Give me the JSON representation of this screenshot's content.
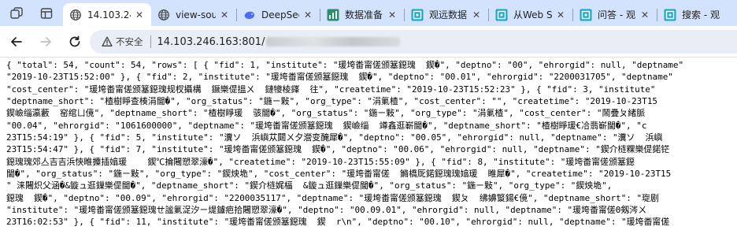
{
  "tabs": [
    {
      "title": "14.103.24",
      "active": true
    },
    {
      "title": "view-sou",
      "active": false
    },
    {
      "title": "DeepSeek",
      "active": false
    },
    {
      "title": "数据准备",
      "active": false
    },
    {
      "title": "观远数据",
      "active": false
    },
    {
      "title": "从Web S",
      "active": false
    },
    {
      "title": "问答 - 观",
      "active": false
    },
    {
      "title": "搜索 - 观",
      "active": false
    }
  ],
  "toolbar": {
    "security_label": "不安全",
    "url": "14.103.246.163:801/"
  },
  "json_lines": [
    "{ \"total\": 54, \"count\": 54, \"rows\": [ { \"fid\": 1, \"institute\": \"瑗垮畨甯傞颁簊鐚瑰  鍥�\", \"deptno\": \"00\", \"ehrorgid\": null, \"deptname\"",
    "\"2019-10-23T15:52:00\" }, { \"fid\": 2, \"institute\": \"瑗垮畨甯傞颁簊鐚瑰  鍥�\", \"deptno\": \"00.01\", \"ehrorgid\": \"2200031705\", \"deptname\"",
    "\"cost_center\": \"瑗垮畨甯傞颁簊鐚瑰规杈攝構  鐝樂偍搵ㄨ  鏈犪棱鎽  往\", \"createtime\": \"2019-10-23T15:52:23\" }, { \"fid\": 3, \"institute\"",
    "\"deptname_short\": \"楂樹睜查楱涓閫�\", \"org_status\": \"鍦ㄧ敤\", \"org_type\": \"涓氭楂\", \"cost_center\": \"\", \"createtime\": \"2019-10-23T15",
    "鍥嶮缁瀛藪  窑绾ㄩ傹\", \"deptname_short\": \"楂樹睜瑗  骇閫�\", \"org_status\": \"鍦ㄧ敤\", \"org_type\": \"涓氭楂\", \"cost_center\": \"鬧疊ㄆ緒脈",
    "\"00.04\", \"ehrorgid\": \"1061600000\", \"deptname\": \"瑗垮畨甯傞颁簊鐚瑰  鍥嶮缁  竴鑫逛嶄閫�\", \"deptname_short\": \"楂樹睜瑗€冾翡嶄閫�\", \"c",
    "23T15:54:19\" }, { \"fid\": 5, \"institute\": \"瀵ソ  浜嶼苁閮ㄨ夕瀯变醃犀�\", \"deptno\": \"00.05\", \"ehrorgid\": null, \"deptname\": \"瀵ソ  浜嶼",
    "23T15:54:47\" }, { \"fid\": 7, \"institute\": \"瑗垮畨甯傞颁簊鐚瑰  鍥�\", \"deptno\": \"00.06\", \"ehrorgid\": null, \"deptname\": \"鍥介梿粿樂偍鍩铓",
    "鐚瑰瑰郊亼吉吉浜悏睢攗插嬆瑗    鍥℃掄闀愬翠濠�\", \"createtime\": \"2019-10-23T15:55:09\" }, { \"fid\": 8, \"institute\": \"瑗垮畨甯傞颁簊鐚",
    "閫�\", \"org_status\": \"鍦ㄧ敤\", \"org_type\": \"鍥炴垝\", \"cost_center\": \"瑗垮畨甯傞  鏅橋厑鍩鐚瑰瑰嬆瑗  睢犀�\", \"createtime\": \"2019-10-23T15",
    "\" 涞闀炽父涵�&鏇ュ逛鏁樂偍閫�\", \"deptname_short\": \"鍥介梿娓楅  &鏇ュ逛鏁樂偍閫�\", \"org_status\": \"鍦ㄧ敤\", \"org_type\": \"鍥炴垝\",",
    "鐚瑰  鍥�\", \"deptno\": \"00.09\", \"ehrorgid\": \"2200035117\", \"deptname\": \"瑗垮畨甯傞颁簊鐚瑰  鍥ㄆ  绋嬶瀪鍚€傹\", \"deptname_short\": \"琁剧",
    "\"institute\": \"瑗垮畨甯傞颁簊鐚瑰ㄝ謐氭浞汐ㄧ煶鐪疤拾闀愬翠濠�\", \"deptno\": \"00.09.01\", \"ehrorgid\": null, \"deptname\": \"瑗垮畨甯傞Θ剱涔ㄨ",
    "23T16:02:53\" }, { \"fid\": 11, \"institute\": \"瑗垮畨甯傞颁簊鐚瑰  鍥  r\\n\", \"deptno\": \"00.10\", \"ehrorgid\": null, \"deptname\": \"瑗垮畨甯傞"
  ]
}
